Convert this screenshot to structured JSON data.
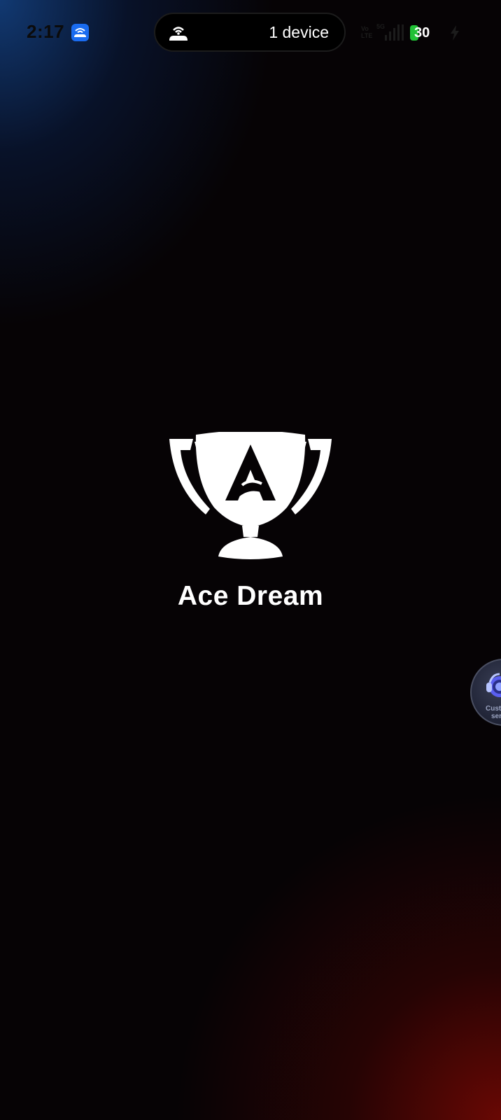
{
  "status_bar": {
    "time": "2:17",
    "hotspot_pill_text": "1 device",
    "network_label": "5G",
    "volte_label": "Vo LTE",
    "battery_percent": "30",
    "app_icon": "hotspot-app-icon",
    "charging_icon": "charging-bolt-icon"
  },
  "splash": {
    "app_name": "Ace Dream",
    "logo_icon": "trophy-logo-icon"
  },
  "floating_support": {
    "label_line1": "Cust",
    "label_line2": "ser",
    "icon": "headset-icon"
  },
  "colors": {
    "top_left_glow": "#123c78",
    "bottom_right_glow": "#6e0804",
    "battery_green": "#21c136",
    "pill_background": "#000000"
  }
}
